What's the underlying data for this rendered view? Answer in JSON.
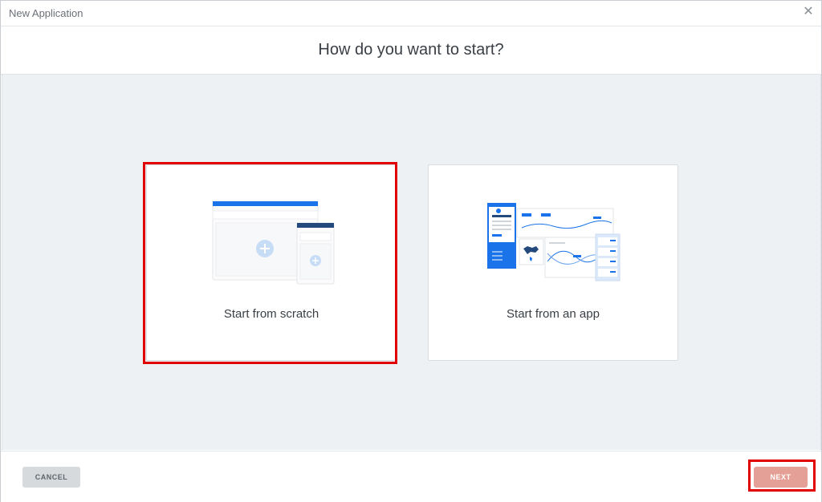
{
  "window": {
    "title": "New Application",
    "close_glyph": "✕"
  },
  "heading": "How do you want to start?",
  "options": [
    {
      "label": "Start from scratch",
      "selected": true
    },
    {
      "label": "Start from an app",
      "selected": false
    }
  ],
  "footer": {
    "cancel_label": "CANCEL",
    "next_label": "NEXT"
  },
  "colors": {
    "accent_blue": "#1a73e8",
    "dark_blue": "#244a7d",
    "plus_circle": "#c7ddf5",
    "next_button": "#e4a096",
    "highlight": "#e00000",
    "content_bg": "#eef1f4"
  },
  "icons": [
    "close-icon",
    "plus-icon",
    "app-template-illustration"
  ]
}
